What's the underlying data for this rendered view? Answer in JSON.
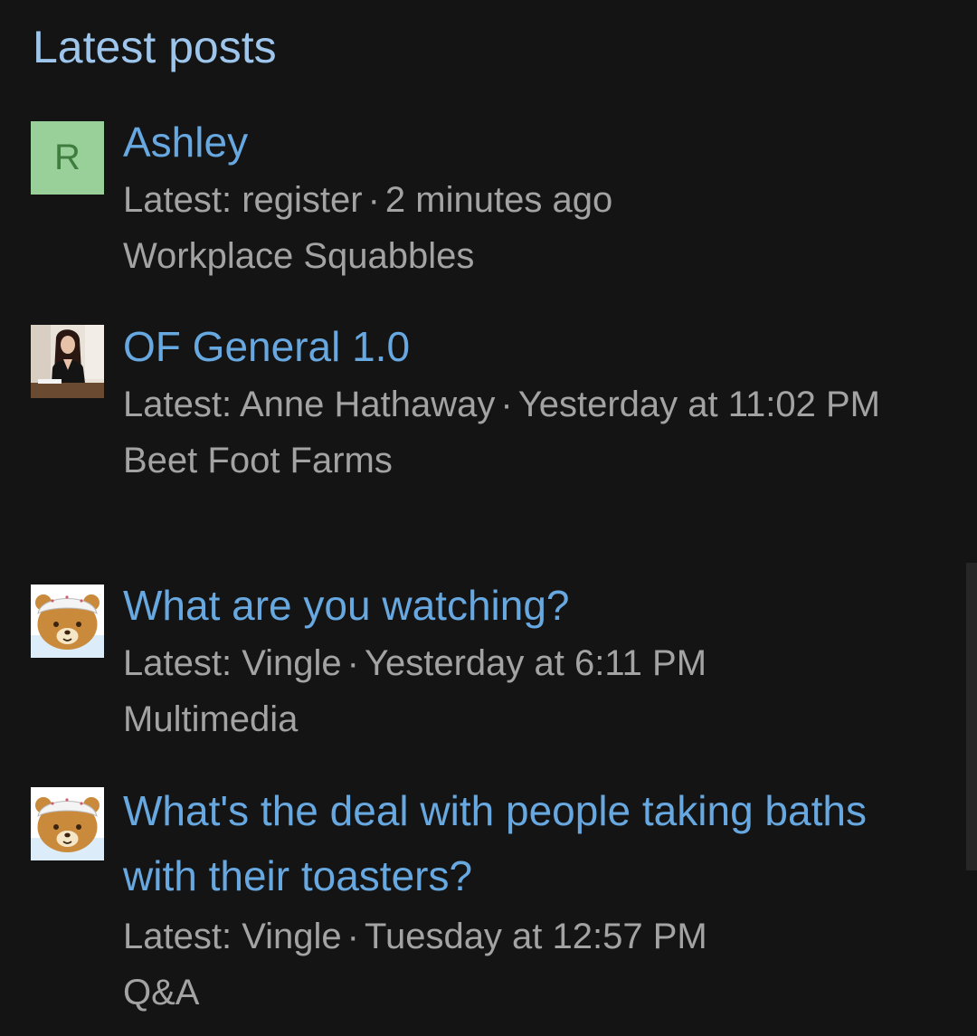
{
  "block": {
    "title": "Latest posts"
  },
  "posts": [
    {
      "avatar": {
        "type": "letter",
        "letter": "R",
        "bg": "#99cf99",
        "fg": "#3f7d3f"
      },
      "title": "Ashley",
      "latest_prefix": "Latest:",
      "user": "register",
      "separator": "·",
      "time": "2 minutes ago",
      "forum": "Workplace Squabbles"
    },
    {
      "avatar": {
        "type": "photo",
        "icon": "woman-portrait-photo"
      },
      "title": "OF General 1.0",
      "latest_prefix": "Latest:",
      "user": "Anne Hathaway",
      "separator": "·",
      "time": "Yesterday at 11:02 PM",
      "forum": "Beet Foot Farms"
    },
    {
      "avatar": {
        "type": "image",
        "icon": "bear-avatar"
      },
      "title": "What are you watching?",
      "latest_prefix": "Latest:",
      "user": "Vingle",
      "separator": "·",
      "time": "Yesterday at 6:11 PM",
      "forum": "Multimedia"
    },
    {
      "avatar": {
        "type": "image",
        "icon": "bear-avatar"
      },
      "title": "What's the deal with people taking baths with their toasters?",
      "latest_prefix": "Latest:",
      "user": "Vingle",
      "separator": "·",
      "time": "Tuesday at 12:57 PM",
      "forum": "Q&A"
    }
  ],
  "colors": {
    "background": "#141414",
    "title": "#9ec6ec",
    "link": "#68a8e0",
    "muted": "#a3a3a3"
  }
}
